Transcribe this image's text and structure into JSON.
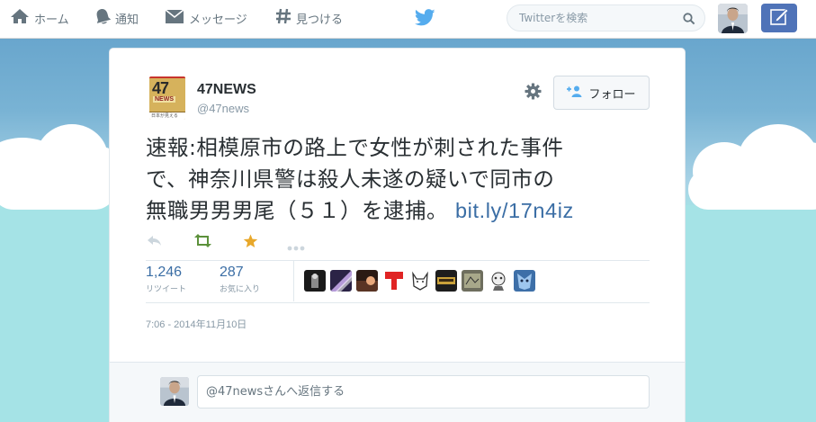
{
  "nav": {
    "home": "ホーム",
    "notifications": "通知",
    "messages": "メッセージ",
    "discover": "見つける"
  },
  "search": {
    "placeholder": "Twitterを検索"
  },
  "tweet": {
    "display_name": "47NEWS",
    "screen_name": "@47news",
    "logo": {
      "big": "47",
      "mid": "NEWS",
      "small": "日本が見える"
    },
    "follow_label": "フォロー",
    "text_lines": [
      "速報:相模原市の路上で女性が刺された事件",
      "で、神奈川県警は殺人未遂の疑いで同市の",
      "無職男男男尾（５１）を逮捕。 "
    ],
    "link": "bit.ly/17n4iz",
    "retweets": {
      "count": "1,246",
      "label": "リツイート"
    },
    "favorites": {
      "count": "287",
      "label": "お気に入り"
    },
    "timestamp": "7:06 - 2014年11月10日",
    "reply_placeholder": "@47newsさんへ返信する"
  },
  "colors": {
    "link": "#3b6ea5",
    "twitter_blue": "#55acee",
    "favorite_star": "#e8a82b",
    "retweet_green": "#5c913b",
    "compose": "#4f73b8"
  },
  "icons": {
    "home": "home-icon",
    "notifications": "bell-icon",
    "messages": "envelope-icon",
    "discover": "hashtag-icon",
    "brand": "twitter-bird-icon",
    "search": "search-icon",
    "compose": "compose-icon",
    "settings": "gear-icon",
    "follow": "add-user-icon",
    "reply": "reply-icon",
    "retweet": "retweet-icon",
    "favorite": "star-icon",
    "more": "more-icon"
  }
}
